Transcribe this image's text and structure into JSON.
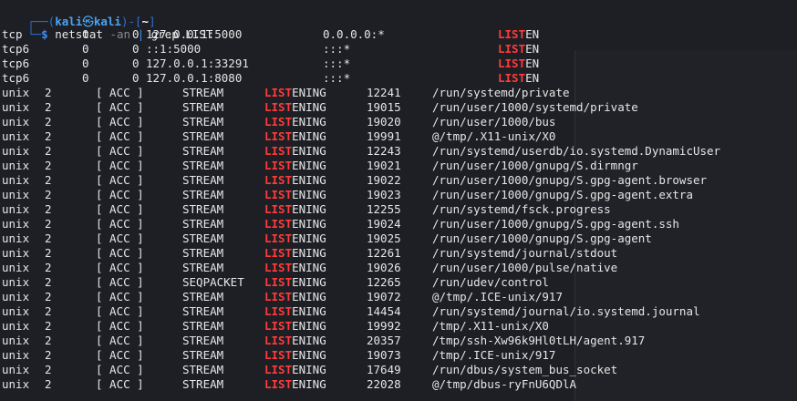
{
  "prompt": {
    "user": "kali",
    "host": "kali",
    "cwd": "~",
    "command": "netstat",
    "flag": "-an",
    "pipe": "|",
    "grep_command": "grep LIST"
  },
  "highlight": "LIST",
  "tcp_rows": [
    {
      "proto": "tcp",
      "recv": "0",
      "send": "0",
      "local": "127.0.0.1:5000",
      "foreign": "0.0.0.0:*",
      "state_hl": "LIST",
      "state_rest": "EN"
    },
    {
      "proto": "tcp6",
      "recv": "0",
      "send": "0",
      "local": "::1:5000",
      "foreign": ":::*",
      "state_hl": "LIST",
      "state_rest": "EN"
    },
    {
      "proto": "tcp6",
      "recv": "0",
      "send": "0",
      "local": "127.0.0.1:33291",
      "foreign": ":::*",
      "state_hl": "LIST",
      "state_rest": "EN"
    },
    {
      "proto": "tcp6",
      "recv": "0",
      "send": "0",
      "local": "127.0.0.1:8080",
      "foreign": ":::*",
      "state_hl": "LIST",
      "state_rest": "EN"
    }
  ],
  "unix_rows": [
    {
      "proto": "unix",
      "refcnt": "2",
      "flags": "[ ACC ]",
      "type": "STREAM",
      "state_hl": "LIST",
      "state_rest": "ENING",
      "inode": "12241",
      "path": "/run/systemd/private"
    },
    {
      "proto": "unix",
      "refcnt": "2",
      "flags": "[ ACC ]",
      "type": "STREAM",
      "state_hl": "LIST",
      "state_rest": "ENING",
      "inode": "19015",
      "path": "/run/user/1000/systemd/private"
    },
    {
      "proto": "unix",
      "refcnt": "2",
      "flags": "[ ACC ]",
      "type": "STREAM",
      "state_hl": "LIST",
      "state_rest": "ENING",
      "inode": "19020",
      "path": "/run/user/1000/bus"
    },
    {
      "proto": "unix",
      "refcnt": "2",
      "flags": "[ ACC ]",
      "type": "STREAM",
      "state_hl": "LIST",
      "state_rest": "ENING",
      "inode": "19991",
      "path": "@/tmp/.X11-unix/X0"
    },
    {
      "proto": "unix",
      "refcnt": "2",
      "flags": "[ ACC ]",
      "type": "STREAM",
      "state_hl": "LIST",
      "state_rest": "ENING",
      "inode": "12243",
      "path": "/run/systemd/userdb/io.systemd.DynamicUser"
    },
    {
      "proto": "unix",
      "refcnt": "2",
      "flags": "[ ACC ]",
      "type": "STREAM",
      "state_hl": "LIST",
      "state_rest": "ENING",
      "inode": "19021",
      "path": "/run/user/1000/gnupg/S.dirmngr"
    },
    {
      "proto": "unix",
      "refcnt": "2",
      "flags": "[ ACC ]",
      "type": "STREAM",
      "state_hl": "LIST",
      "state_rest": "ENING",
      "inode": "19022",
      "path": "/run/user/1000/gnupg/S.gpg-agent.browser"
    },
    {
      "proto": "unix",
      "refcnt": "2",
      "flags": "[ ACC ]",
      "type": "STREAM",
      "state_hl": "LIST",
      "state_rest": "ENING",
      "inode": "19023",
      "path": "/run/user/1000/gnupg/S.gpg-agent.extra"
    },
    {
      "proto": "unix",
      "refcnt": "2",
      "flags": "[ ACC ]",
      "type": "STREAM",
      "state_hl": "LIST",
      "state_rest": "ENING",
      "inode": "12255",
      "path": "/run/systemd/fsck.progress"
    },
    {
      "proto": "unix",
      "refcnt": "2",
      "flags": "[ ACC ]",
      "type": "STREAM",
      "state_hl": "LIST",
      "state_rest": "ENING",
      "inode": "19024",
      "path": "/run/user/1000/gnupg/S.gpg-agent.ssh"
    },
    {
      "proto": "unix",
      "refcnt": "2",
      "flags": "[ ACC ]",
      "type": "STREAM",
      "state_hl": "LIST",
      "state_rest": "ENING",
      "inode": "19025",
      "path": "/run/user/1000/gnupg/S.gpg-agent"
    },
    {
      "proto": "unix",
      "refcnt": "2",
      "flags": "[ ACC ]",
      "type": "STREAM",
      "state_hl": "LIST",
      "state_rest": "ENING",
      "inode": "12261",
      "path": "/run/systemd/journal/stdout"
    },
    {
      "proto": "unix",
      "refcnt": "2",
      "flags": "[ ACC ]",
      "type": "STREAM",
      "state_hl": "LIST",
      "state_rest": "ENING",
      "inode": "19026",
      "path": "/run/user/1000/pulse/native"
    },
    {
      "proto": "unix",
      "refcnt": "2",
      "flags": "[ ACC ]",
      "type": "SEQPACKET",
      "state_hl": "LIST",
      "state_rest": "ENING",
      "inode": "12265",
      "path": "/run/udev/control"
    },
    {
      "proto": "unix",
      "refcnt": "2",
      "flags": "[ ACC ]",
      "type": "STREAM",
      "state_hl": "LIST",
      "state_rest": "ENING",
      "inode": "19072",
      "path": "@/tmp/.ICE-unix/917"
    },
    {
      "proto": "unix",
      "refcnt": "2",
      "flags": "[ ACC ]",
      "type": "STREAM",
      "state_hl": "LIST",
      "state_rest": "ENING",
      "inode": "14454",
      "path": "/run/systemd/journal/io.systemd.journal"
    },
    {
      "proto": "unix",
      "refcnt": "2",
      "flags": "[ ACC ]",
      "type": "STREAM",
      "state_hl": "LIST",
      "state_rest": "ENING",
      "inode": "19992",
      "path": "/tmp/.X11-unix/X0"
    },
    {
      "proto": "unix",
      "refcnt": "2",
      "flags": "[ ACC ]",
      "type": "STREAM",
      "state_hl": "LIST",
      "state_rest": "ENING",
      "inode": "20357",
      "path": "/tmp/ssh-Xw96k9Hl0tLH/agent.917"
    },
    {
      "proto": "unix",
      "refcnt": "2",
      "flags": "[ ACC ]",
      "type": "STREAM",
      "state_hl": "LIST",
      "state_rest": "ENING",
      "inode": "19073",
      "path": "/tmp/.ICE-unix/917"
    },
    {
      "proto": "unix",
      "refcnt": "2",
      "flags": "[ ACC ]",
      "type": "STREAM",
      "state_hl": "LIST",
      "state_rest": "ENING",
      "inode": "17649",
      "path": "/run/dbus/system_bus_socket"
    },
    {
      "proto": "unix",
      "refcnt": "2",
      "flags": "[ ACC ]",
      "type": "STREAM",
      "state_hl": "LIST",
      "state_rest": "ENING",
      "inode": "22028",
      "path": "@/tmp/dbus-ryFnU6QDlA"
    }
  ],
  "colors": {
    "background": "#1d1f24",
    "text": "#e6e6e6",
    "highlight": "#ff3b3b",
    "prompt_blue": "#3f8ff5"
  }
}
